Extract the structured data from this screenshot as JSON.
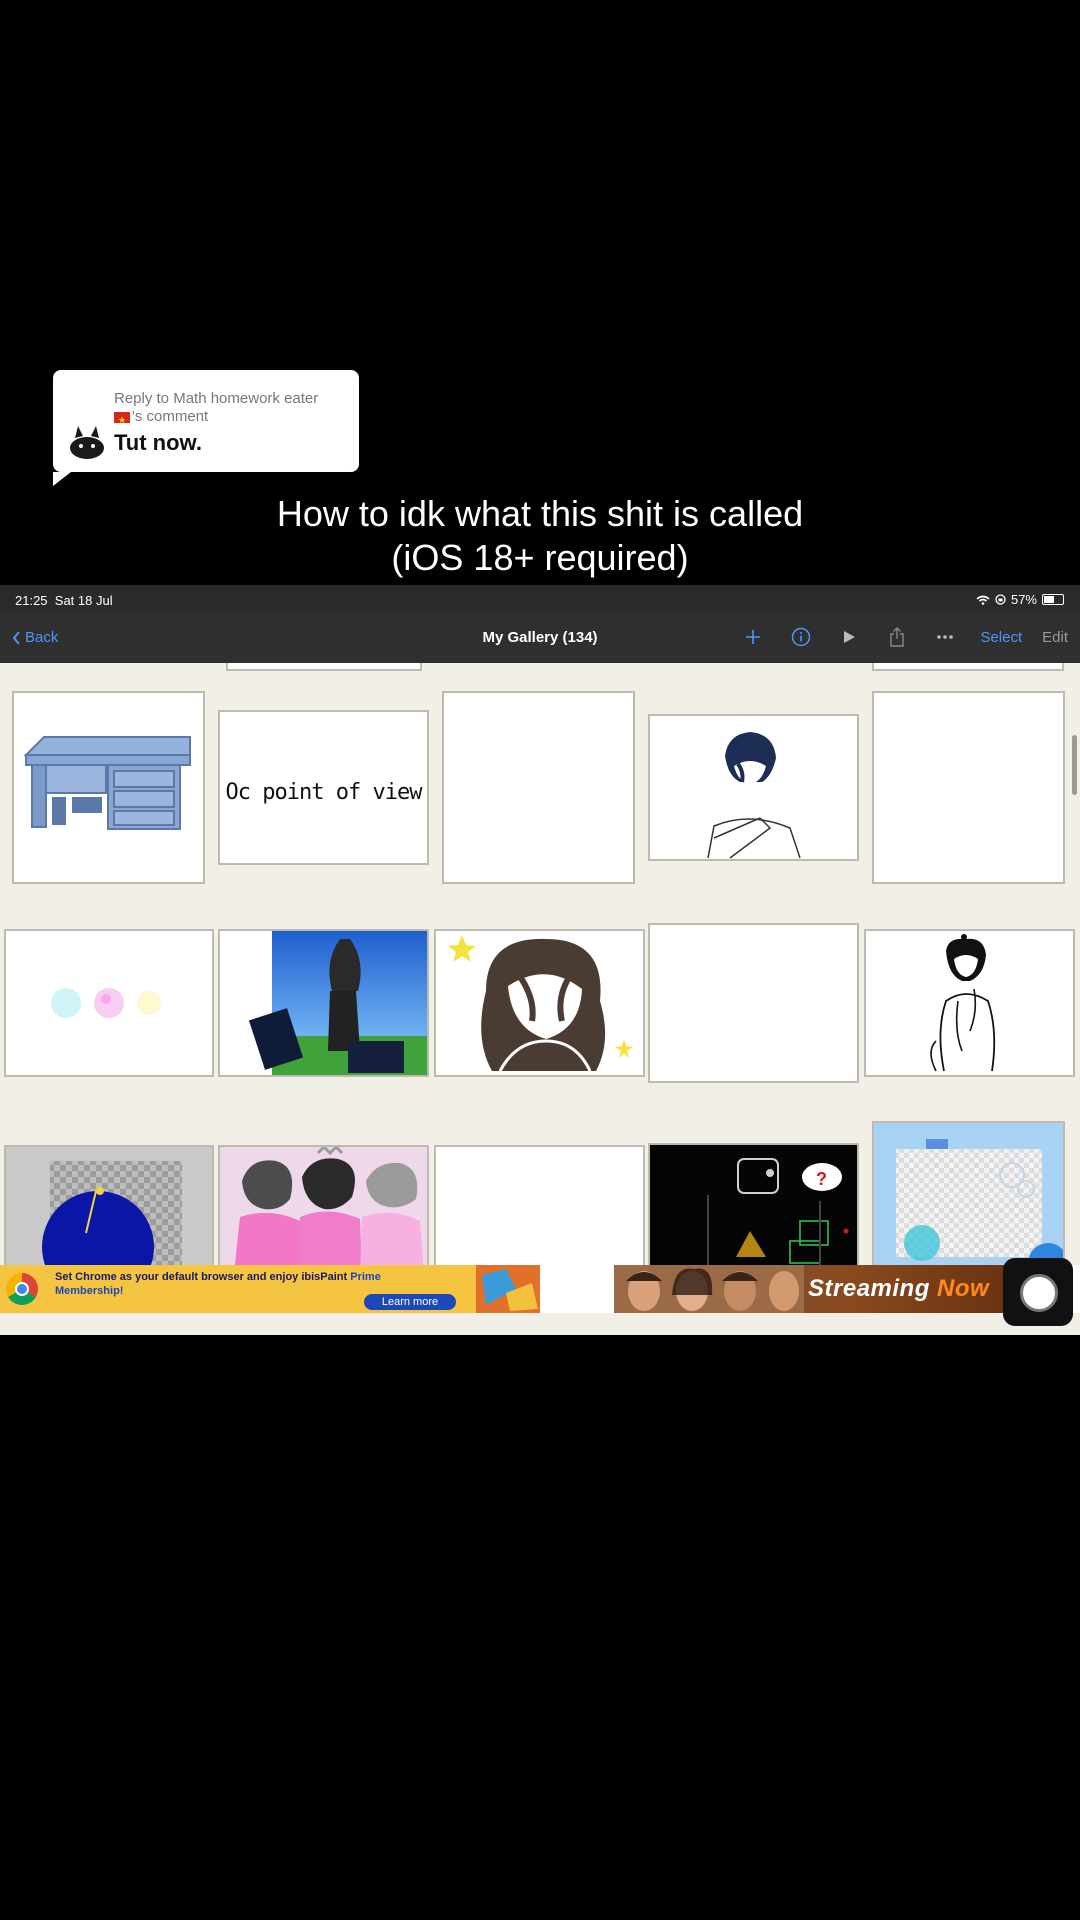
{
  "reply": {
    "prefix": "Reply to Math homework eater",
    "suffix": "'s comment",
    "text": "Tut now."
  },
  "caption": {
    "line1": "How to idk what this shit is called",
    "line2": "(iOS 18+ required)"
  },
  "status_bar": {
    "time": "21:25",
    "date": "Sat 18 Jul",
    "battery": "57%"
  },
  "nav": {
    "back_label": "Back",
    "title": "My Gallery (134)",
    "select_label": "Select",
    "edit_label": "Edit",
    "icons": [
      "plus-icon",
      "info-icon",
      "play-icon",
      "share-icon",
      "more-icon"
    ]
  },
  "gallery": {
    "thumbnail_text": "Oc point of view"
  },
  "ad": {
    "text_main": "Set Chrome as your default browser and enjoy ibisPaint",
    "text_accent": "Prime",
    "text_line2": "Membership!",
    "cta": "Learn more",
    "stream_text": "Streaming",
    "stream_accent": "Now"
  },
  "colors": {
    "accent_blue": "#4f93ff",
    "gallery_bg": "#f2f0e6",
    "nav_bg": "#2f2f2f",
    "ad_yellow": "#f5c542"
  }
}
